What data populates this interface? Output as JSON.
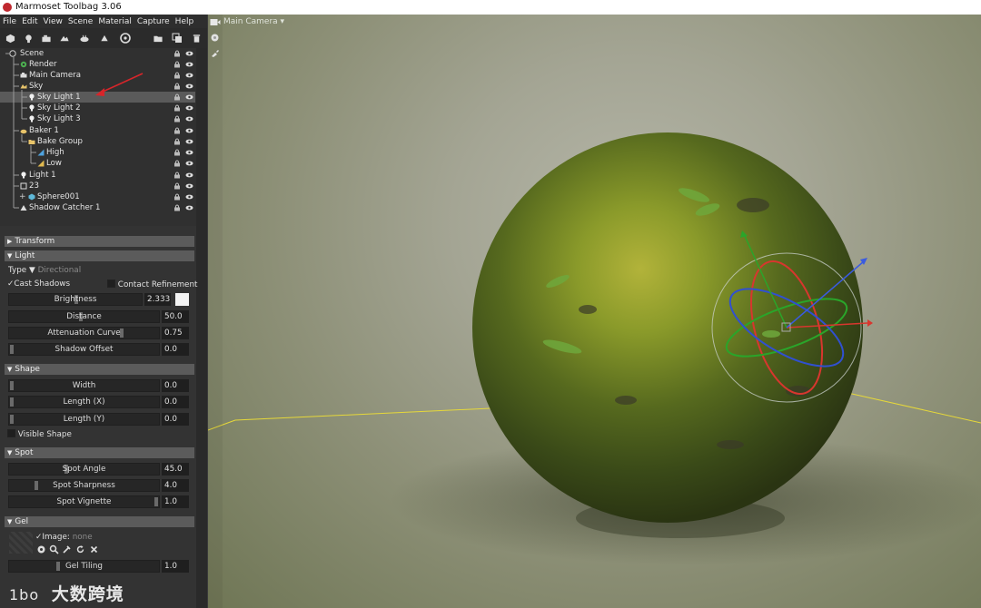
{
  "window": {
    "title": "Marmoset Toolbag 3.06"
  },
  "menu": [
    "File",
    "Edit",
    "View",
    "Scene",
    "Material",
    "Capture",
    "Help"
  ],
  "viewport": {
    "camera_label": "Main Camera"
  },
  "scene_tree": [
    {
      "label": "Scene",
      "level": 0,
      "icon": "scene-icon"
    },
    {
      "label": "Render",
      "level": 1,
      "icon": "render-gear-icon"
    },
    {
      "label": "Main Camera",
      "level": 1,
      "icon": "camera-icon"
    },
    {
      "label": "Sky",
      "level": 1,
      "icon": "sky-icon"
    },
    {
      "label": "Sky Light 1",
      "level": 2,
      "icon": "light-bulb-icon",
      "selected": true
    },
    {
      "label": "Sky Light 2",
      "level": 2,
      "icon": "light-bulb-icon"
    },
    {
      "label": "Sky Light 3",
      "level": 2,
      "icon": "light-bulb-icon"
    },
    {
      "label": "Baker 1",
      "level": 1,
      "icon": "baker-icon"
    },
    {
      "label": "Bake Group",
      "level": 2,
      "icon": "folder-icon"
    },
    {
      "label": "High",
      "level": 3,
      "icon": "mesh-high-icon"
    },
    {
      "label": "Low",
      "level": 3,
      "icon": "mesh-low-icon"
    },
    {
      "label": "Light 1",
      "level": 1,
      "icon": "light-bulb-icon"
    },
    {
      "label": "23",
      "level": 1,
      "icon": "object-icon"
    },
    {
      "label": "Sphere001",
      "level": 2,
      "icon": "mesh-icon"
    },
    {
      "label": "Shadow Catcher 1",
      "level": 1,
      "icon": "shadow-catcher-icon"
    }
  ],
  "sections": {
    "transform": "Transform",
    "light": "Light",
    "shape": "Shape",
    "spot": "Spot",
    "gel": "Gel"
  },
  "light": {
    "type_label": "Type",
    "type_value": "Directional",
    "cast_shadows": "Cast Shadows",
    "contact_refinement": "Contact Refinement",
    "brightness_label": "Brightness",
    "brightness": "2.333",
    "distance_label": "Distance",
    "distance": "50.0",
    "attenuation_label": "Attenuation Curve",
    "attenuation": "0.75",
    "shadow_offset_label": "Shadow Offset",
    "shadow_offset": "0.0"
  },
  "shape": {
    "width_label": "Width",
    "width": "0.0",
    "length_x_label": "Length (X)",
    "length_x": "0.0",
    "length_y_label": "Length (Y)",
    "length_y": "0.0",
    "visible_shape": "Visible Shape"
  },
  "spot": {
    "angle_label": "Spot Angle",
    "angle": "45.0",
    "sharpness_label": "Spot Sharpness",
    "sharpness": "4.0",
    "vignette_label": "Spot Vignette",
    "vignette": "1.0"
  },
  "gel": {
    "image_label": "Image:",
    "image_value": "none",
    "tiling_label": "Gel Tiling",
    "tiling": "1.0"
  },
  "watermark": {
    "text": "大数跨境",
    "logo_text": "1bo"
  }
}
